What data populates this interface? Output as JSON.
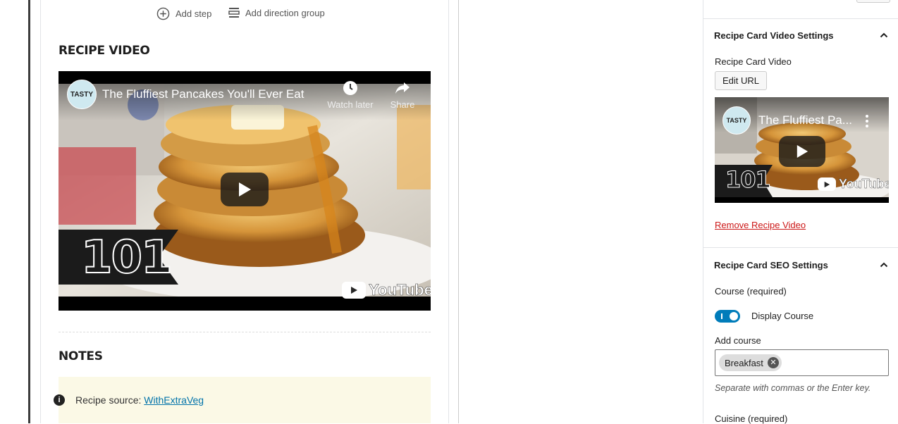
{
  "editor": {
    "toolbar": {
      "add_step": "Add step",
      "add_direction_group": "Add direction group"
    },
    "recipe_video": {
      "heading": "RECIPE VIDEO",
      "channel_badge": "TASTY",
      "title": "The Fluffiest Pancakes You'll Ever Eat",
      "watch_later": "Watch later",
      "share": "Share",
      "overlay_number": "101",
      "youtube_brand": "YouTube"
    },
    "notes": {
      "heading": "NOTES",
      "info_icon": "i",
      "source_label": "Recipe source:",
      "source_link": "WithExtraVeg"
    }
  },
  "sidebar": {
    "video_settings": {
      "title": "Recipe Card Video Settings",
      "field_label": "Recipe Card Video",
      "edit_url_button": "Edit URL",
      "thumb_badge": "TASTY",
      "thumb_title": "The Fluffiest Pa...",
      "thumb_number": "101",
      "thumb_brand": "YouTube",
      "remove_link": "Remove Recipe Video"
    },
    "seo_settings": {
      "title": "Recipe Card SEO Settings",
      "course_label": "Course (required)",
      "display_course_toggle": {
        "label": "Display Course",
        "checked": true
      },
      "add_course_label": "Add course",
      "course_tokens": [
        "Breakfast"
      ],
      "help_text": "Separate with commas or the Enter key.",
      "cuisine_label": "Cuisine (required)"
    }
  },
  "colors": {
    "accent": "#007cba",
    "danger": "#cc1818",
    "notes_bg": "#fbf9e6",
    "link": "#0073aa"
  }
}
